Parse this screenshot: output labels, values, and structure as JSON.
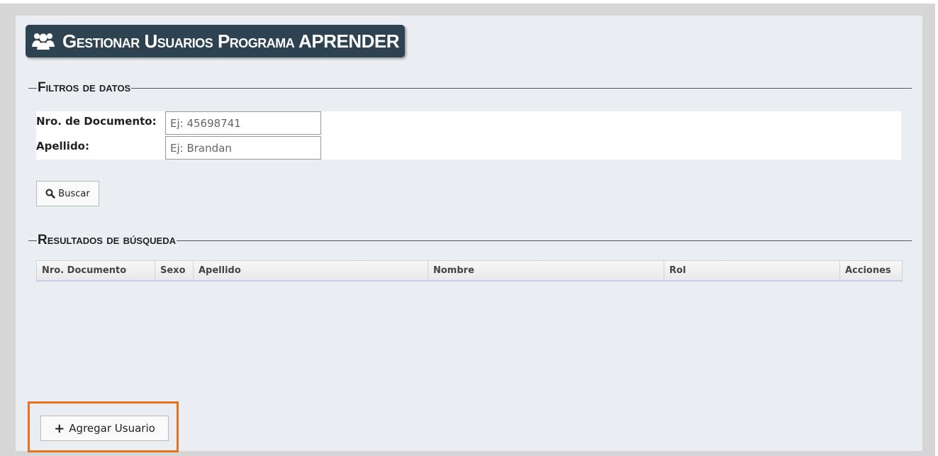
{
  "header": {
    "title": "Gestionar Usuarios Programa APRENDER",
    "icon": "users-icon"
  },
  "filters": {
    "legend": "Filtros de datos",
    "document_label": "Nro. de Documento:",
    "document_placeholder": "Ej: 45698741",
    "lastname_label": "Apellido:",
    "lastname_placeholder": "Ej: Brandan",
    "search_button": "Buscar",
    "search_icon": "search-icon"
  },
  "results": {
    "legend": "Resultados de búsqueda",
    "columns": [
      "Nro. Documento",
      "Sexo",
      "Apellido",
      "Nombre",
      "Rol",
      "Acciones"
    ]
  },
  "actions": {
    "add_user_button": "Agregar Usuario",
    "add_icon": "plus-icon",
    "highlight_color": "#e8731c"
  }
}
